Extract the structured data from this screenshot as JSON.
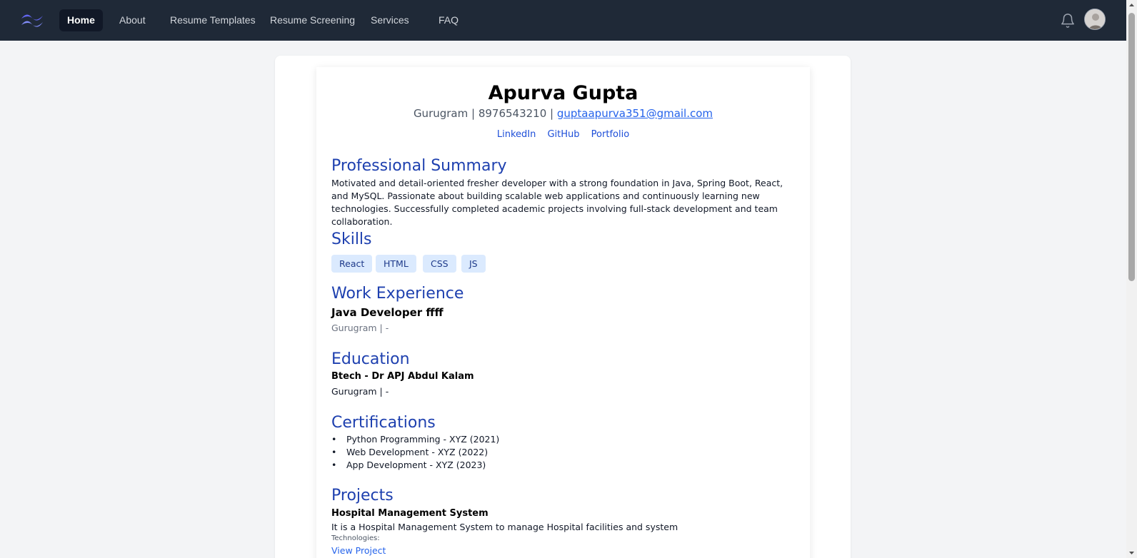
{
  "nav": {
    "items": [
      {
        "label": "Home"
      },
      {
        "label": "About"
      },
      {
        "label": "Resume Templates"
      },
      {
        "label": "Resume Screening"
      },
      {
        "label": "Services"
      },
      {
        "label": "FAQ"
      }
    ],
    "active": "Home",
    "icons": {
      "logo": "tailwind-wave-logo",
      "notifications": "bell-icon",
      "avatar": "user-avatar"
    }
  },
  "resume": {
    "name": "Apurva Gupta",
    "contact": {
      "location": "Gurugram",
      "sep1": " | ",
      "phone": "8976543210",
      "sep2": " | ",
      "email": "guptaapurva351@gmail.com"
    },
    "links": [
      "LinkedIn",
      "GitHub",
      "Portfolio"
    ],
    "summary": {
      "heading": "Professional Summary",
      "text": "Motivated and detail-oriented fresher developer with a strong foundation in Java, Spring Boot, React, and MySQL. Passionate about building scalable web applications and continuously learning new technologies. Successfully completed academic projects involving full-stack development and team collaboration."
    },
    "skills": {
      "heading": "Skills",
      "items": [
        "React",
        "HTML",
        "CSS",
        "JS"
      ]
    },
    "experience": {
      "heading": "Work Experience",
      "title": "Java Developer ffff",
      "meta": "Gurugram | -"
    },
    "education": {
      "heading": "Education",
      "degree": "Btech - Dr APJ Abdul Kalam",
      "meta": "Gurugram | -"
    },
    "certifications": {
      "heading": "Certifications",
      "items": [
        "Python Programming - XYZ (2021)",
        "Web Development - XYZ (2022)",
        "App Development - XYZ (2023)"
      ]
    },
    "projects": {
      "heading": "Projects",
      "title": "Hospital Management System",
      "description": "It is a Hospital Management System to manage Hospital facilities and system",
      "technologies_label": "Technologies:",
      "view_label": "View Project"
    }
  },
  "colors": {
    "navbar": "#1f2937",
    "heading": "#1e40af",
    "link": "#2563eb",
    "chip_bg": "#dbeafe",
    "page_bg": "#f3f4f6"
  }
}
